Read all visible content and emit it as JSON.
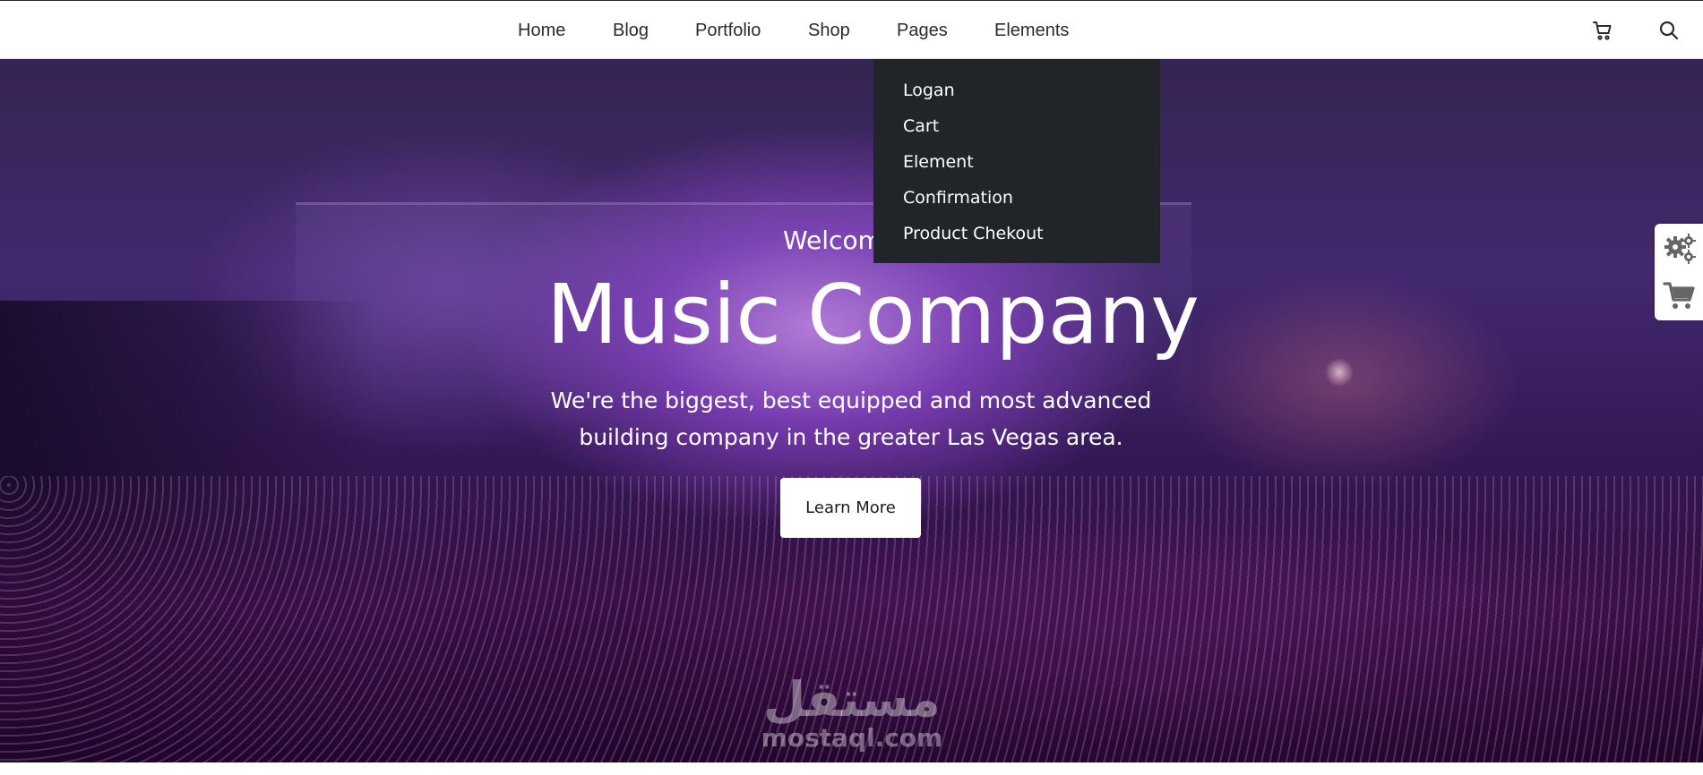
{
  "nav": {
    "items": [
      {
        "label": "Home"
      },
      {
        "label": "Blog"
      },
      {
        "label": "Portfolio"
      },
      {
        "label": "Shop"
      },
      {
        "label": "Pages"
      },
      {
        "label": "Elements"
      }
    ],
    "icons": {
      "cart": "shopping-cart-icon",
      "search": "search-icon"
    }
  },
  "dropdown": {
    "items": [
      {
        "label": "Logan"
      },
      {
        "label": "Cart"
      },
      {
        "label": "Element"
      },
      {
        "label": "Confirmation"
      },
      {
        "label": "Product Chekout"
      }
    ]
  },
  "hero": {
    "welcome": "Welcom",
    "title": "Music Company",
    "subtitle_line1": "We're the biggest, best equipped and most advanced",
    "subtitle_line2": "building company in the greater Las Vegas area.",
    "button_label": "Learn More"
  },
  "watermark": {
    "arabic": "مستقل",
    "latin": "mostaql.com"
  },
  "side_widget": {
    "icons": [
      "gears-icon",
      "shopping-cart-icon"
    ]
  },
  "colors": {
    "dropdown_bg": "#212529",
    "nav_text": "#2b2b2b",
    "hero_accent": "#8a3fd6"
  }
}
